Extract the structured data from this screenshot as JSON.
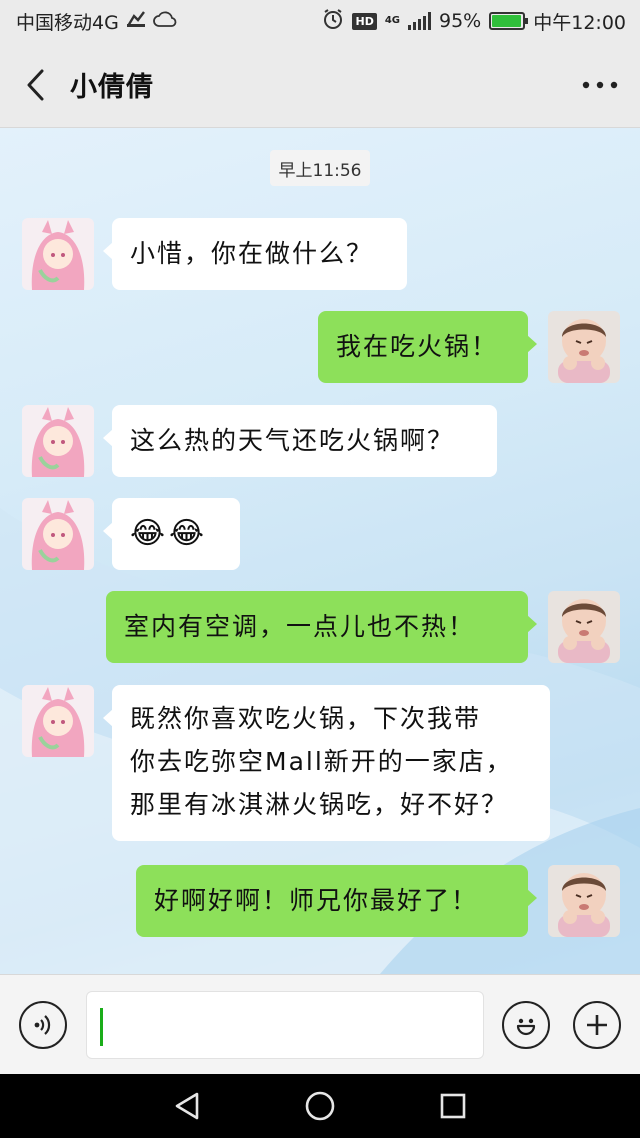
{
  "status_bar": {
    "carrier": "中国移动4G",
    "network": "4G",
    "battery_percent": "95%",
    "battery_level": 0.95,
    "time": "中午12:00",
    "hd_label": "HD"
  },
  "header": {
    "title": "小倩倩",
    "more_label": "···"
  },
  "chat": {
    "timestamp": "早上11:56",
    "messages": [
      {
        "direction": "in",
        "lines": [
          "小惜，你在做什么？"
        ]
      },
      {
        "direction": "out",
        "lines": [
          "我在吃火锅！"
        ]
      },
      {
        "direction": "in",
        "lines": [
          "这么热的天气还吃火锅啊？"
        ]
      },
      {
        "direction": "in",
        "lines": [
          "😂😂"
        ]
      },
      {
        "direction": "out",
        "lines": [
          "室内有空调，一点儿也不热！"
        ]
      },
      {
        "direction": "in",
        "lines": [
          "既然你喜欢吃火锅，下次我带",
          "你去吃弥空Mall新开的一家店，",
          "那里有冰淇淋火锅吃，好不好？"
        ]
      },
      {
        "direction": "out",
        "lines": [
          "好啊好啊！师兄你最好了！"
        ]
      }
    ]
  },
  "input_bar": {
    "value": ""
  },
  "colors": {
    "out_bubble": "#8de05a",
    "in_bubble": "#ffffff",
    "caret": "#1aad19"
  }
}
